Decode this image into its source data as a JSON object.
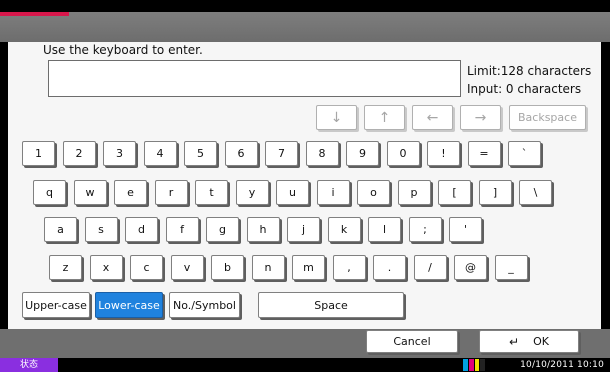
{
  "prompt": "Use the keyboard to enter.",
  "input_value": "",
  "limit_line": "Limit:128 characters",
  "input_line": "Input:  0 characters",
  "nav": {
    "down": "↓",
    "up": "↑",
    "left": "←",
    "right": "→",
    "backspace": "Backspace"
  },
  "rows": {
    "row1": [
      "1",
      "2",
      "3",
      "4",
      "5",
      "6",
      "7",
      "8",
      "9",
      "0",
      "!",
      "=",
      "`"
    ],
    "row2": [
      "q",
      "w",
      "e",
      "r",
      "t",
      "y",
      "u",
      "i",
      "o",
      "p",
      "[",
      "]",
      "\\"
    ],
    "row3": [
      "a",
      "s",
      "d",
      "f",
      "g",
      "h",
      "j",
      "k",
      "l",
      ";",
      "'"
    ],
    "row4": [
      "z",
      "x",
      "c",
      "v",
      "b",
      "n",
      "m",
      ",",
      ".",
      "/",
      "@",
      "_"
    ]
  },
  "modes": {
    "upper": "Upper-case",
    "lower": "Lower-case",
    "numsym": "No./Symbol",
    "space": "Space",
    "selected": "Lower-case"
  },
  "actions": {
    "cancel": "Cancel",
    "ok": "OK",
    "ok_icon": "enter-icon"
  },
  "status": {
    "tab_label": "状态",
    "datetime": "10/10/2011  10:10",
    "toner_colors": [
      "#00a0e0",
      "#e0007a",
      "#f0e000",
      "#222222"
    ]
  },
  "colors": {
    "accent": "#d8174b",
    "selected_key": "#1f82de",
    "status_tab": "#8a2fe0"
  }
}
